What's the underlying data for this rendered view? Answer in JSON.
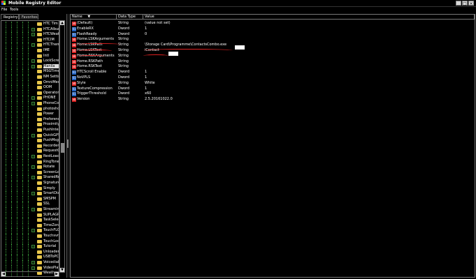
{
  "window": {
    "title": "Mobile Registry Editor",
    "minimize_glyph": "_",
    "maximize_glyph": "□",
    "close_glyph": "×"
  },
  "menu": [
    "File",
    "Tools"
  ],
  "tabs": [
    "Registry",
    "Favorites"
  ],
  "tree": {
    "items": [
      {
        "label": "HTC Tim",
        "expandable": false,
        "selected": false
      },
      {
        "label": "HTCAlbum",
        "expandable": true,
        "selected": false
      },
      {
        "label": "HTCWeat",
        "expandable": true,
        "selected": false
      },
      {
        "label": "HTCIM",
        "expandable": false,
        "selected": false
      },
      {
        "label": "HTCTheme",
        "expandable": true,
        "selected": false
      },
      {
        "label": "IME",
        "expandable": false,
        "selected": false
      },
      {
        "label": "Intl",
        "expandable": false,
        "selected": false
      },
      {
        "label": "LockScree",
        "expandable": true,
        "selected": false
      },
      {
        "label": "Manila",
        "expandable": true,
        "selected": true
      },
      {
        "label": "MSGTimer",
        "expandable": false,
        "selected": false
      },
      {
        "label": "NM Setting",
        "expandable": false,
        "selected": false
      },
      {
        "label": "OmniMedia",
        "expandable": false,
        "selected": false
      },
      {
        "label": "OOM",
        "expandable": false,
        "selected": false
      },
      {
        "label": "Operator",
        "expandable": false,
        "selected": false
      },
      {
        "label": "PHONE",
        "expandable": true,
        "selected": false
      },
      {
        "label": "PhoneCon",
        "expandable": true,
        "selected": false
      },
      {
        "label": "photosho",
        "expandable": false,
        "selected": false
      },
      {
        "label": "Power",
        "expandable": false,
        "selected": false
      },
      {
        "label": "Preference",
        "expandable": false,
        "selected": false
      },
      {
        "label": "Proximity",
        "expandable": false,
        "selected": false
      },
      {
        "label": "PushInter",
        "expandable": false,
        "selected": false
      },
      {
        "label": "QuickGPS",
        "expandable": true,
        "selected": false
      },
      {
        "label": "PushMsg",
        "expandable": false,
        "selected": false
      },
      {
        "label": "Recorder",
        "expandable": false,
        "selected": false
      },
      {
        "label": "RequestCall",
        "expandable": false,
        "selected": false
      },
      {
        "label": "RestLoad",
        "expandable": true,
        "selected": false
      },
      {
        "label": "RingTone",
        "expandable": false,
        "selected": false
      },
      {
        "label": "Rotate",
        "expandable": true,
        "selected": false
      },
      {
        "label": "ScreenLock",
        "expandable": false,
        "selected": false
      },
      {
        "label": "SharedRes",
        "expandable": true,
        "selected": false
      },
      {
        "label": "Signature",
        "expandable": false,
        "selected": false
      },
      {
        "label": "Simply",
        "expandable": false,
        "selected": false
      },
      {
        "label": "SmartDial",
        "expandable": true,
        "selected": false
      },
      {
        "label": "SMSPM",
        "expandable": false,
        "selected": false
      },
      {
        "label": "SSL",
        "expandable": false,
        "selected": false
      },
      {
        "label": "Streaming",
        "expandable": true,
        "selected": false
      },
      {
        "label": "SUPLAGPS",
        "expandable": false,
        "selected": false
      },
      {
        "label": "TaskSelect",
        "expandable": false,
        "selected": false
      },
      {
        "label": "TimeZones",
        "expandable": false,
        "selected": false
      },
      {
        "label": "TouchFLO",
        "expandable": true,
        "selected": false
      },
      {
        "label": "Touchsvr",
        "expandable": false,
        "selected": false
      },
      {
        "label": "TouchLock",
        "expandable": false,
        "selected": false
      },
      {
        "label": "Tutorial",
        "expandable": true,
        "selected": false
      },
      {
        "label": "Unloader",
        "expandable": false,
        "selected": false
      },
      {
        "label": "USBToPC",
        "expandable": false,
        "selected": false
      },
      {
        "label": "Voicedial",
        "expandable": true,
        "selected": false
      },
      {
        "label": "VideoPlayer",
        "expandable": true,
        "selected": false
      },
      {
        "label": "Weather",
        "expandable": false,
        "selected": false
      }
    ]
  },
  "values": {
    "columns": [
      "Name",
      "Data Type",
      "Value"
    ],
    "sort_glyph": "▼",
    "rows": [
      {
        "name": "(Default)",
        "type": "String",
        "data": "(value not set)",
        "kind": "str"
      },
      {
        "name": "EnableRX",
        "type": "Dword",
        "data": "1",
        "kind": "dw"
      },
      {
        "name": "FlashReady",
        "type": "Dword",
        "data": "0",
        "kind": "dw"
      },
      {
        "name": "Home.LSKArguments",
        "type": "String",
        "data": "",
        "kind": "str"
      },
      {
        "name": "Home.LSKPath",
        "type": "String",
        "data": "\\Storage Card\\Programme\\ContactsCombo.exe",
        "kind": "str"
      },
      {
        "name": "Home.LSKText",
        "type": "String",
        "data": "iContact",
        "kind": "str"
      },
      {
        "name": "Home.RSKArguments",
        "type": "String",
        "data": "",
        "kind": "str"
      },
      {
        "name": "Home.RSKPath",
        "type": "String",
        "data": "",
        "kind": "str"
      },
      {
        "name": "Home.RSKText",
        "type": "String",
        "data": "",
        "kind": "str"
      },
      {
        "name": "HTCScroll Enable",
        "type": "Dword",
        "data": "1",
        "kind": "dw"
      },
      {
        "name": "NoVPLS",
        "type": "Dword",
        "data": "1",
        "kind": "dw"
      },
      {
        "name": "Style",
        "type": "String",
        "data": "White",
        "kind": "str"
      },
      {
        "name": "TextureCompression",
        "type": "Dword",
        "data": "1",
        "kind": "dw"
      },
      {
        "name": "TriggerThreshold",
        "type": "Dword",
        "data": "x60",
        "kind": "dw"
      },
      {
        "name": "Version",
        "type": "String",
        "data": "2.5.20161022.0",
        "kind": "str"
      }
    ]
  },
  "colors": {
    "background": "#000000",
    "folder": "#e8c64b",
    "string_icon": "#dd2222",
    "dword_icon": "#1f5fbf",
    "tree_lines": "#3a9a3a",
    "annotation": "#e02020"
  }
}
